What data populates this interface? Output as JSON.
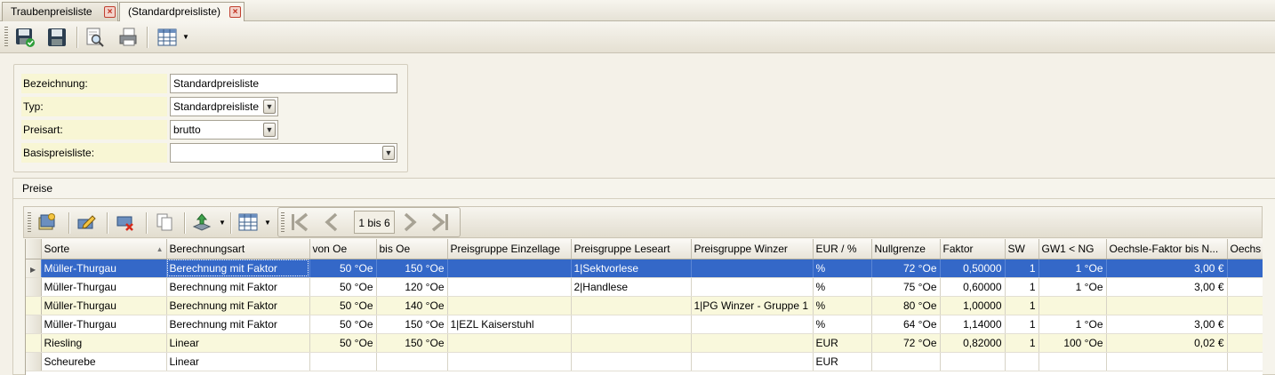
{
  "tabs": [
    {
      "label": "Traubenpreisliste"
    },
    {
      "label": "(Standardpreisliste)"
    }
  ],
  "toolbar": {
    "icons": [
      "save-close-icon",
      "save-icon",
      "print-preview-icon",
      "print-icon",
      "grid-layout-icon"
    ]
  },
  "form": {
    "bezeichnung_label": "Bezeichnung:",
    "bezeichnung_value": "Standardpreisliste",
    "typ_label": "Typ:",
    "typ_value": "Standardpreisliste",
    "preisart_label": "Preisart:",
    "preisart_value": "brutto",
    "basispreisliste_label": "Basispreisliste:",
    "basispreisliste_value": ""
  },
  "preise": {
    "title": "Preise",
    "pager": "1 bis 6",
    "columns": [
      "Sorte",
      "Berechnungsart",
      "von Oe",
      "bis Oe",
      "Preisgruppe Einzellage",
      "Preisgruppe Leseart",
      "Preisgruppe Winzer",
      "EUR / %",
      "Nullgrenze",
      "Faktor",
      "SW",
      "GW1 < NG",
      "Oechsle-Faktor bis N...",
      "Oechs"
    ],
    "rows": [
      [
        "Müller-Thurgau",
        "Berechnung mit Faktor",
        "50 °Oe",
        "150 °Oe",
        "",
        "1|Sektvorlese",
        "",
        "%",
        "72 °Oe",
        "0,50000",
        "1",
        "1 °Oe",
        "3,00 €",
        ""
      ],
      [
        "Müller-Thurgau",
        "Berechnung mit Faktor",
        "50 °Oe",
        "120 °Oe",
        "",
        "2|Handlese",
        "",
        "%",
        "75 °Oe",
        "0,60000",
        "1",
        "1 °Oe",
        "3,00 €",
        ""
      ],
      [
        "Müller-Thurgau",
        "Berechnung mit Faktor",
        "50 °Oe",
        "140 °Oe",
        "",
        "",
        "1|PG Winzer - Gruppe 1",
        "%",
        "80 °Oe",
        "1,00000",
        "1",
        "",
        "",
        ""
      ],
      [
        "Müller-Thurgau",
        "Berechnung mit Faktor",
        "50 °Oe",
        "150 °Oe",
        "1|EZL Kaiserstuhl",
        "",
        "",
        "%",
        "64 °Oe",
        "1,14000",
        "1",
        "1 °Oe",
        "3,00 €",
        ""
      ],
      [
        "Riesling",
        "Linear",
        "50 °Oe",
        "150 °Oe",
        "",
        "",
        "",
        "EUR",
        "72 °Oe",
        "0,82000",
        "1",
        "100 °Oe",
        "0,02 €",
        ""
      ],
      [
        "Scheurebe",
        "Linear",
        "",
        "",
        "",
        "",
        "",
        "EUR",
        "",
        "",
        "",
        "",
        "",
        ""
      ]
    ]
  },
  "colors": {
    "selected_row": "#3468c8",
    "alt_row": "#f9f8dc",
    "label_bg": "#f8f6d4"
  }
}
